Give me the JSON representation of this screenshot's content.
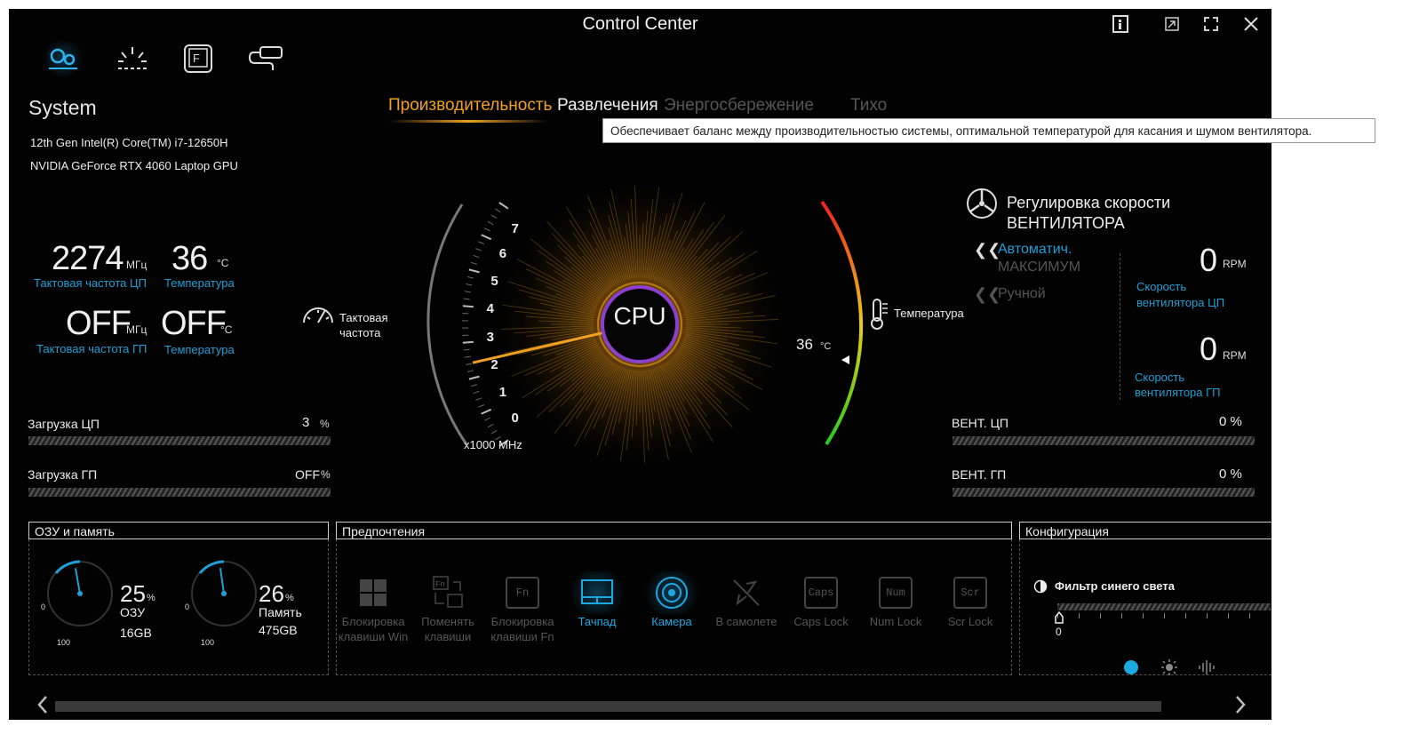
{
  "window": {
    "title": "Control Center"
  },
  "window_buttons": [
    "info-icon",
    "restore-icon",
    "fullscreen-icon",
    "close-icon"
  ],
  "nav_icons": [
    "system-gear-icon",
    "lighting-icon",
    "fn-key-icon",
    "connection-icon"
  ],
  "system": {
    "title": "System",
    "cpu_name": "12th Gen Intel(R) Core(TM) i7-12650H",
    "gpu_name": "NVIDIA GeForce RTX 4060 Laptop GPU",
    "cpu_clock_value": "2274",
    "cpu_clock_unit": "МГц",
    "cpu_clock_label": "Тактовая частота ЦП",
    "cpu_temp_value": "36",
    "cpu_temp_unit": "°C",
    "cpu_temp_label": "Температура",
    "gpu_clock_value": "OFF",
    "gpu_clock_unit": "МГц",
    "gpu_clock_label": "Тактовая частота ГП",
    "gpu_temp_value": "OFF",
    "gpu_temp_unit": "°C",
    "gpu_temp_label": "Температура"
  },
  "modes": {
    "items": [
      "Производительность",
      "Развлечения",
      "Энергосбережение",
      "Тихо"
    ],
    "active": "Производительность",
    "tooltip": "Обеспечивает баланс между производительностью системы, оптимальной температурой для касания и шумом вентилятора."
  },
  "gauge": {
    "center_label": "CPU",
    "clock_label": "Тактовая частота",
    "scale_ticks": [
      "0",
      "1",
      "2",
      "3",
      "4",
      "5",
      "6",
      "7"
    ],
    "scale_unit": "x1000 MHz",
    "clock_value_khz": 2.274,
    "temp_label": "Температура",
    "temp_value": "36",
    "temp_unit": "°C"
  },
  "fan": {
    "title_line1": "Регулировка скорости",
    "title_line2": "ВЕНТИЛЯТОРА",
    "auto_label": "Автоматич.",
    "max_label": "МАКСИМУМ",
    "manual_label": "Ручной",
    "cpu_rpm": "0",
    "cpu_rpm_unit": "RPM",
    "cpu_label": "Скорость вентилятора ЦП",
    "gpu_rpm": "0",
    "gpu_rpm_unit": "RPM",
    "gpu_label": "Скорость вентилятора ГП"
  },
  "loads": {
    "cpu_label": "Загрузка ЦП",
    "cpu_value": "3",
    "cpu_unit": "%",
    "gpu_label": "Загрузка ГП",
    "gpu_value": "OFF",
    "gpu_unit": "%",
    "fan_cpu_label": "ВЕНТ. ЦП",
    "fan_cpu_value": "0 %",
    "fan_gpu_label": "ВЕНТ. ГП",
    "fan_gpu_value": "0 %"
  },
  "memory": {
    "title": "ОЗУ и память",
    "ram_percent": "25",
    "ram_label": "ОЗУ",
    "ram_size": "16GB",
    "disk_percent": "26",
    "disk_label": "Память",
    "disk_size": "475GB",
    "pct_unit": "%",
    "min_label": "0",
    "max_label": "100"
  },
  "preferences": {
    "title": "Предпочтения",
    "items": [
      {
        "label": "Блокировка клавиши Win",
        "icon": "windows-lock-icon",
        "key": ""
      },
      {
        "label": "Поменять клавиши",
        "icon": "swap-keys-icon",
        "key": "Fn"
      },
      {
        "label": "Блокировка клавиши Fn",
        "icon": "fn-lock-icon",
        "key": "Fn"
      },
      {
        "label": "Тачпад",
        "icon": "touchpad-icon",
        "key": ""
      },
      {
        "label": "Камера",
        "icon": "camera-icon",
        "key": ""
      },
      {
        "label": "В самолете",
        "icon": "airplane-icon",
        "key": ""
      },
      {
        "label": "Caps Lock",
        "icon": "caps-lock-icon",
        "key": "Caps"
      },
      {
        "label": "Num Lock",
        "icon": "num-lock-icon",
        "key": "Num"
      },
      {
        "label": "Scr Lock",
        "icon": "scroll-lock-icon",
        "key": "Scr"
      }
    ],
    "active": [
      "Тачпад",
      "Камера"
    ]
  },
  "config": {
    "title": "Конфигурация",
    "blue_filter_label": "Фильтр синего света",
    "blue_filter_value": "0",
    "mode_icons": [
      "blue-light-icon",
      "brightness-icon",
      "audio-icon"
    ]
  },
  "colors": {
    "accent_orange": "#f0a020",
    "accent_cyan": "#1e9fd6",
    "temp_green": "#33cc33",
    "temp_red": "#ee2222"
  }
}
